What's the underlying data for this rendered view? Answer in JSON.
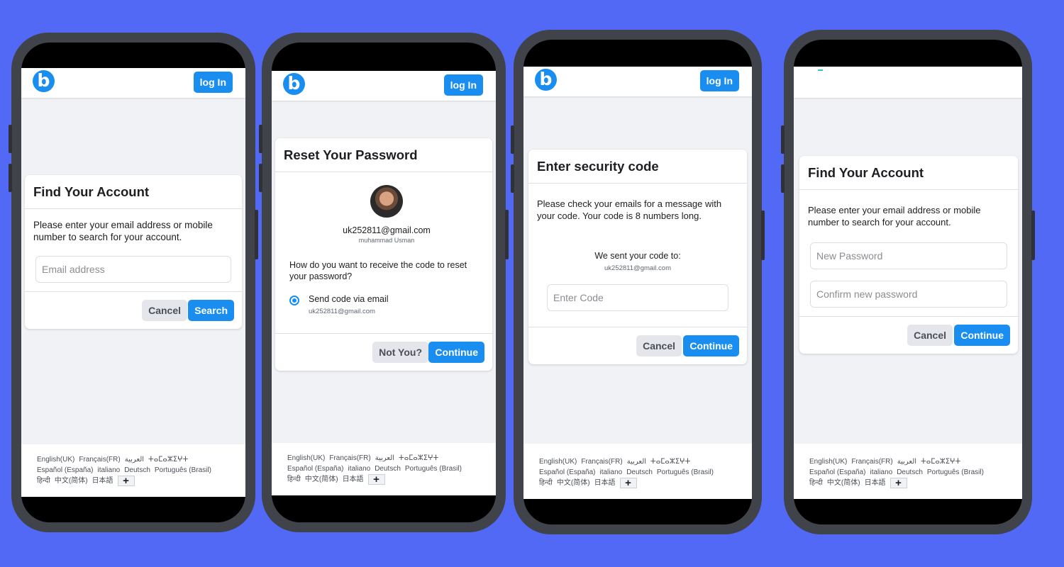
{
  "header": {
    "logo_letter": "b",
    "login_label": "log In"
  },
  "footer": {
    "row1": [
      "English(UK)",
      "Français(FR)",
      "العربية",
      "ⵜⴰⵎⴰⵣⵉⵖⵜ"
    ],
    "row2": [
      "Español (España)",
      "italiano",
      "Deutsch",
      "Português (Brasil)"
    ],
    "row3": [
      "हिन्दी",
      "中文(简体)",
      "日本語"
    ],
    "more_label": "+"
  },
  "screen1": {
    "title": "Find Your Account",
    "description": "Please enter your email address or mobile number to search for your account.",
    "email_placeholder": "Email address",
    "cancel_label": "Cancel",
    "search_label": "Search"
  },
  "screen2": {
    "title": "Reset Your Password",
    "email": "uk252811@gmail.com",
    "name": "muhammad Usman",
    "question": "How do you want to receive the code to reset your password?",
    "option_label": "Send code via email",
    "option_email": "uk252811@gmail.com",
    "not_you_label": "Not You?",
    "continue_label": "Continue"
  },
  "screen3": {
    "title": "Enter security code",
    "description": "Please check your emails for a message with your code. Your code is 8 numbers long.",
    "sent_label": "We sent your code to:",
    "sent_email": "uk252811@gmail.com",
    "code_placeholder": "Enter Code",
    "cancel_label": "Cancel",
    "continue_label": "Continue"
  },
  "screen4": {
    "title": "Find Your Account",
    "description": "Please enter your email address or mobile number to search for your account.",
    "new_password_placeholder": "New Password",
    "confirm_password_placeholder": "Confirm new password",
    "cancel_label": "Cancel",
    "continue_label": "Continue"
  },
  "colors": {
    "background": "#5169f5",
    "accent": "#1a8ef0",
    "phone_frame": "#41434a"
  }
}
